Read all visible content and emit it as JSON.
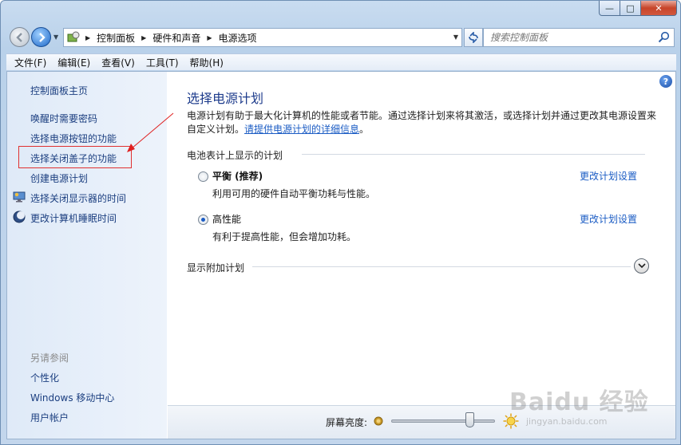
{
  "window": {
    "close_glyph": "✕",
    "max_glyph": "□",
    "min_glyph": "—"
  },
  "address": {
    "crumbs": [
      "控制面板",
      "硬件和声音",
      "电源选项"
    ]
  },
  "search": {
    "placeholder": "搜索控制面板"
  },
  "menu": [
    "文件(F)",
    "编辑(E)",
    "查看(V)",
    "工具(T)",
    "帮助(H)"
  ],
  "sidebar": {
    "home": "控制面板主页",
    "links": [
      {
        "label": "唤醒时需要密码",
        "icon": ""
      },
      {
        "label": "选择电源按钮的功能",
        "icon": ""
      },
      {
        "label": "选择关闭盖子的功能",
        "icon": ""
      },
      {
        "label": "创建电源计划",
        "icon": ""
      },
      {
        "label": "选择关闭显示器的时间",
        "icon": "monitor-icon"
      },
      {
        "label": "更改计算机睡眠时间",
        "icon": "moon-icon"
      }
    ],
    "see_also_title": "另请参阅",
    "see_also": [
      "个性化",
      "Windows 移动中心",
      "用户帐户"
    ]
  },
  "main": {
    "title": "选择电源计划",
    "desc_text": "电源计划有助于最大化计算机的性能或者节能。通过选择计划来将其激活，或选择计划并通过更改其电源设置来自定义计划。",
    "desc_link": "请提供电源计划的详细信息",
    "desc_end": "。",
    "battery_group": "电池表计上显示的计划",
    "plans": [
      {
        "name": "平衡 (推荐)",
        "description": "利用可用的硬件自动平衡功耗与性能。",
        "selected": false,
        "link": "更改计划设置"
      },
      {
        "name": "高性能",
        "description": "有利于提高性能，但会增加功耗。",
        "selected": true,
        "link": "更改计划设置"
      }
    ],
    "extra_group": "显示附加计划"
  },
  "brightness": {
    "label": "屏幕亮度:",
    "level_percent": 78
  },
  "watermark": {
    "main": "Baidu 经验",
    "sub": "jingyan.baidu.com"
  }
}
